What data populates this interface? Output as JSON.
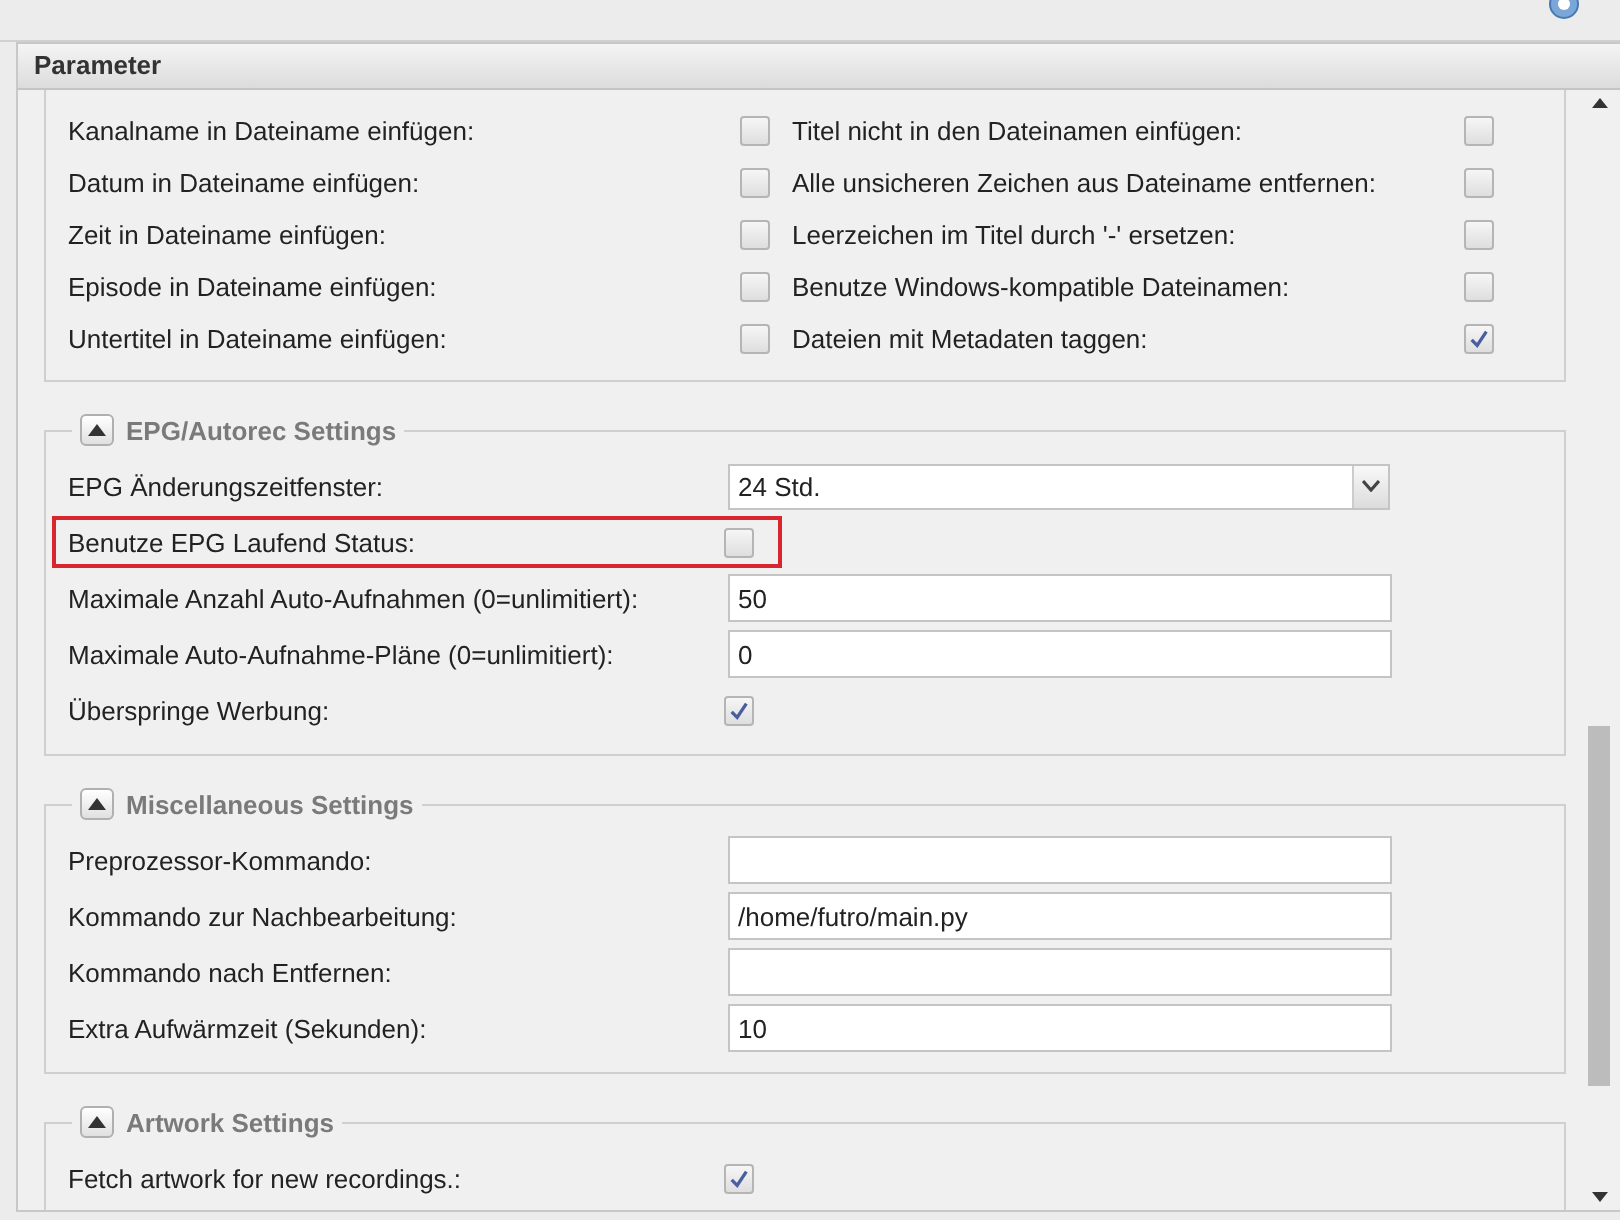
{
  "panel": {
    "title": "Parameter"
  },
  "file_options": [
    {
      "left": {
        "label": "Kanalname in Dateiname einfügen:",
        "checked": false
      },
      "right": {
        "label": "Titel nicht in den Dateinamen einfügen:",
        "checked": false
      }
    },
    {
      "left": {
        "label": "Datum in Dateiname einfügen:",
        "checked": false
      },
      "right": {
        "label": "Alle unsicheren Zeichen aus Dateiname entfernen:",
        "checked": false
      }
    },
    {
      "left": {
        "label": "Zeit in Dateiname einfügen:",
        "checked": false
      },
      "right": {
        "label": "Leerzeichen im Titel durch '-' ersetzen:",
        "checked": false
      }
    },
    {
      "left": {
        "label": "Episode in Dateiname einfügen:",
        "checked": false
      },
      "right": {
        "label": "Benutze Windows-kompatible Dateinamen:",
        "checked": false
      }
    },
    {
      "left": {
        "label": "Untertitel in Dateiname einfügen:",
        "checked": false
      },
      "right": {
        "label": "Dateien mit Metadaten taggen:",
        "checked": true
      }
    }
  ],
  "sections": [
    {
      "title": "EPG/Autorec Settings",
      "expanded": true,
      "fields": [
        {
          "kind": "select",
          "label": "EPG Änderungszeitfenster:",
          "value": "24 Std.",
          "highlighted": false
        },
        {
          "kind": "checkbox",
          "label": "Benutze EPG Laufend Status:",
          "checked": false,
          "highlighted": true
        },
        {
          "kind": "text",
          "label": "Maximale Anzahl Auto-Aufnahmen (0=unlimitiert):",
          "value": "50",
          "highlighted": false
        },
        {
          "kind": "text",
          "label": "Maximale Auto-Aufnahme-Pläne (0=unlimitiert):",
          "value": "0",
          "highlighted": false
        },
        {
          "kind": "checkbox",
          "label": "Überspringe Werbung:",
          "checked": true,
          "highlighted": false
        }
      ]
    },
    {
      "title": "Miscellaneous Settings",
      "expanded": true,
      "fields": [
        {
          "kind": "text",
          "label": "Preprozessor-Kommando:",
          "highlighted": false
        },
        {
          "kind": "text",
          "label": "Kommando zur Nachbearbeitung:",
          "value": "/home/futro/main.py",
          "highlighted": false
        },
        {
          "kind": "text",
          "label": "Kommando nach Entfernen:",
          "highlighted": false
        },
        {
          "kind": "text",
          "label": "Extra Aufwärmzeit (Sekunden):",
          "value": "10",
          "highlighted": false
        }
      ]
    },
    {
      "title": "Artwork Settings",
      "expanded": true,
      "fields": [
        {
          "kind": "checkbox",
          "label": "Fetch artwork for new recordings.:",
          "checked": true,
          "highlighted": false
        }
      ]
    }
  ]
}
